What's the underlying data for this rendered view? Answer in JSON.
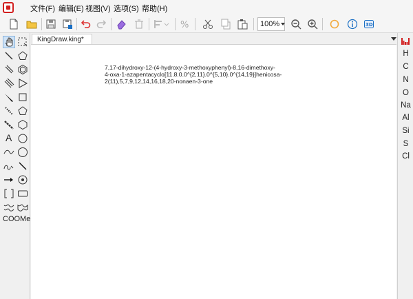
{
  "app": {
    "document_tab": "KingDraw.king*"
  },
  "menu": {
    "items": [
      "文件(F)",
      "编辑(E)",
      "视图(V)",
      "选项(S)",
      "帮助(H)"
    ]
  },
  "toolbar": {
    "zoom_value": "100%"
  },
  "left_panel": {
    "text_tools": [
      "A",
      "COOMe"
    ]
  },
  "canvas": {
    "molecule_name": "7,17-dihydroxy-12-(4-hydroxy-3-methoxyphenyl)-8,16-dimethoxy-\n4-oxa-1-azapentacyclo[11.8.0.0^{2,11}.0^{5,10}.0^{14,19}]henicosa-\n2(11),5,7,9,12,14,16,18,20-nonaen-3-one"
  },
  "elements": [
    "H",
    "C",
    "N",
    "O",
    "Na",
    "Al",
    "Si",
    "S",
    "Cl"
  ],
  "colors": {
    "logo_red": "#d21f1f",
    "accent_blue": "#1a6fc4",
    "active_tool_bg": "#cfe3f7"
  }
}
